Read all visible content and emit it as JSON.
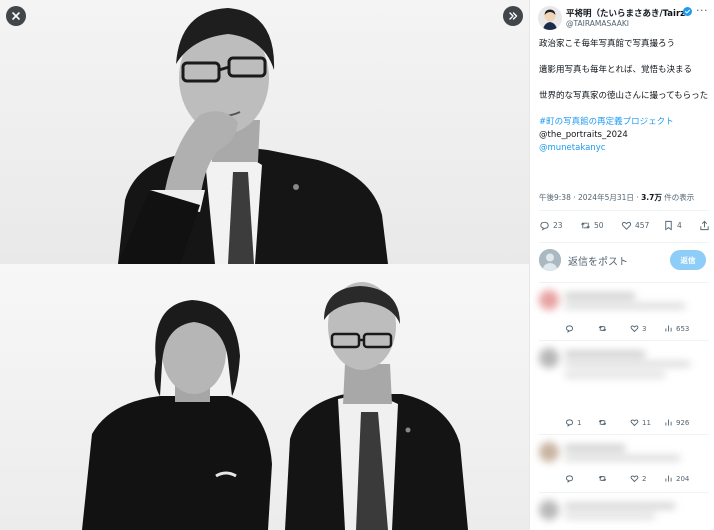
{
  "viewer": {
    "close_icon": "close-icon",
    "expand_icon": "chevron-double-right-icon"
  },
  "author": {
    "name": "平将明（たいらまさあき/Tairz",
    "handle": "@TAIRAMASAAKI",
    "verified_color": "#1d9bf0"
  },
  "tweet": {
    "line1": "政治家こそ毎年写真館で写真撮ろう",
    "line2": "遺影用写真も毎年とれば、覚悟も決まる",
    "line3": "世界的な写真家の徳山さんに撮ってもらった",
    "hashtag": "#町の写真館の再定義プロジェクト",
    "mention1": "@the_portraits_2024",
    "mention2": "@munetakanyc",
    "time": "午後9:38 · 2024年5月31日 · ",
    "views": "3.7万",
    "views_suffix": " 件の表示"
  },
  "actions": {
    "replies": "23",
    "retweets": "50",
    "likes": "457",
    "bookmarks": "4"
  },
  "reply_box": {
    "placeholder": "返信をポスト",
    "button": "返信"
  },
  "replies": [
    {
      "replies": "",
      "retweets": "",
      "likes": "3",
      "views": "653"
    },
    {
      "replies": "1",
      "retweets": "",
      "likes": "11",
      "views": "926"
    },
    {
      "replies": "",
      "retweets": "",
      "likes": "2",
      "views": "204"
    }
  ],
  "colors": {
    "link": "#1d9bf0",
    "muted": "#536471",
    "reply_button": "#8ecdf8"
  }
}
